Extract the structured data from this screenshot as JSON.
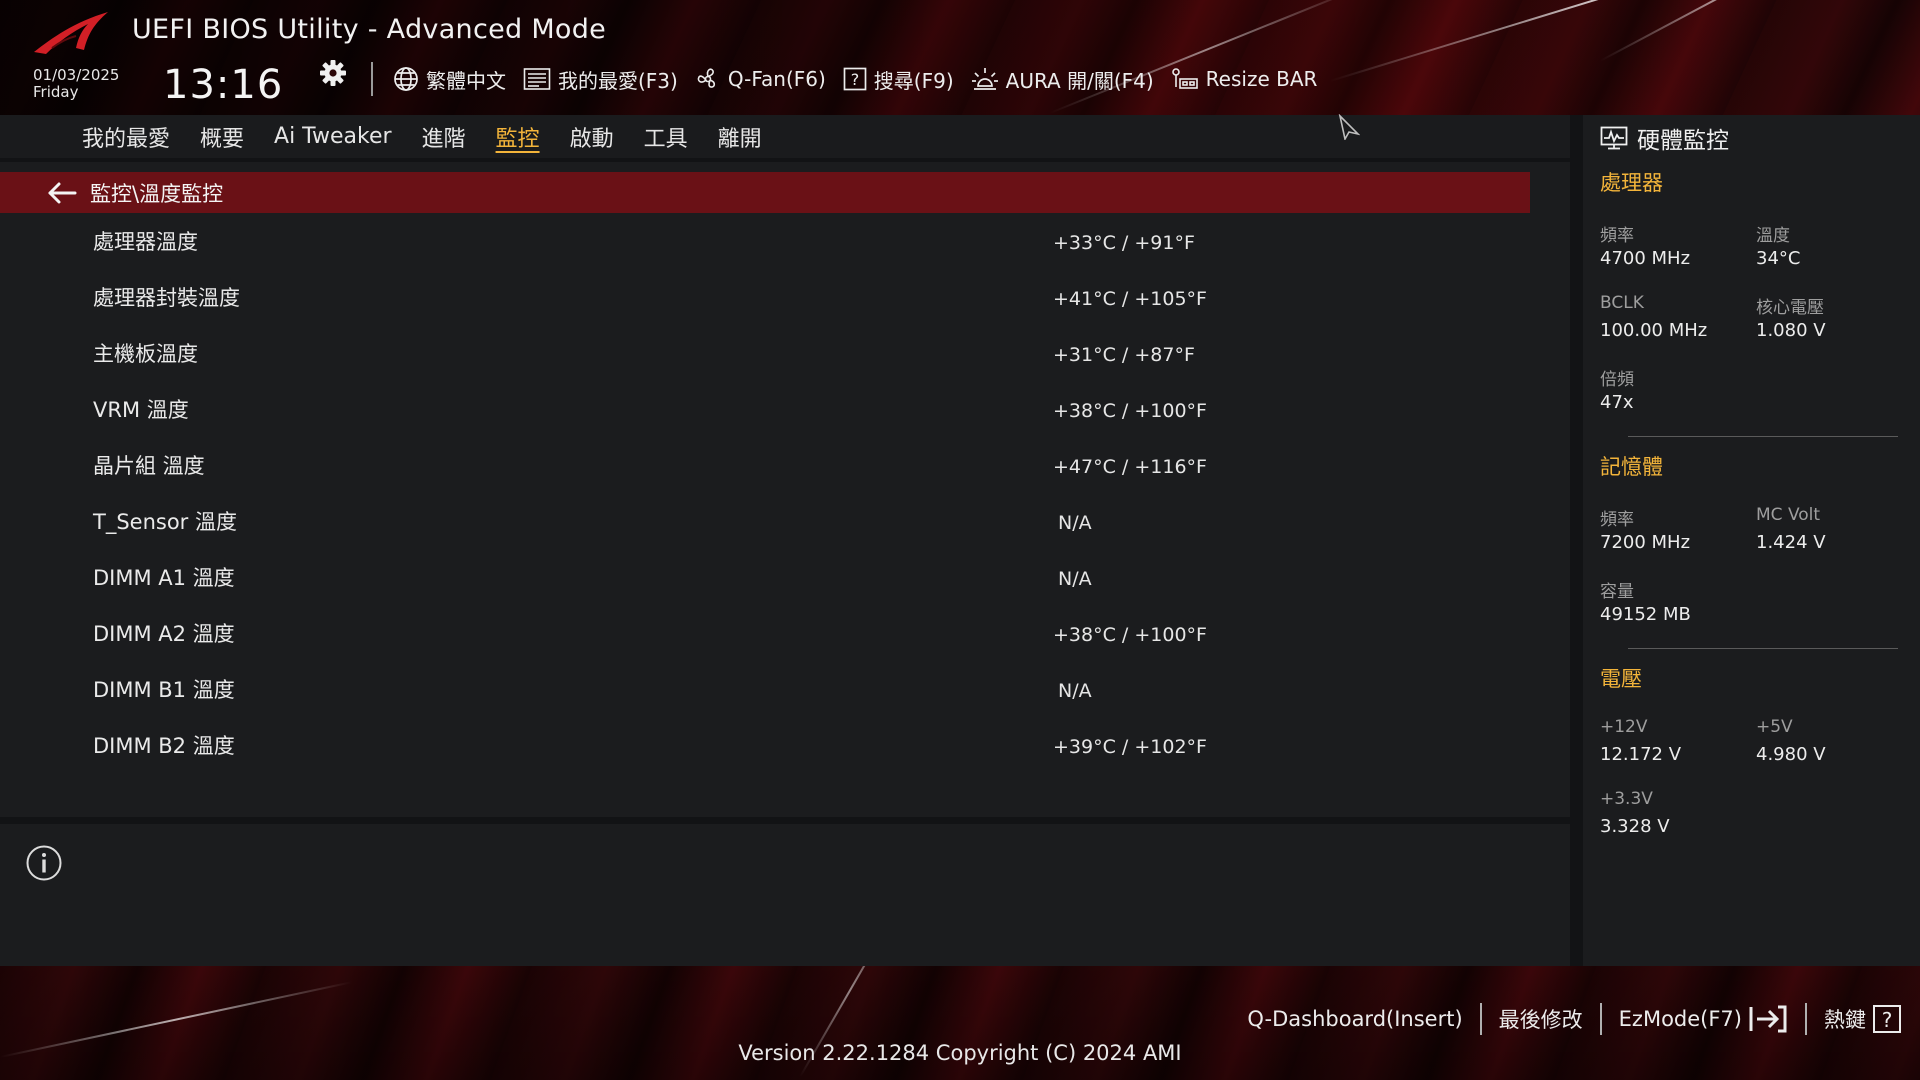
{
  "header": {
    "title": "UEFI BIOS Utility - Advanced Mode",
    "date": "01/03/2025",
    "weekday": "Friday",
    "time": "13:16"
  },
  "toolbar": {
    "language": "繁體中文",
    "favorites": "我的最愛(F3)",
    "qfan": "Q-Fan(F6)",
    "search": "搜尋(F9)",
    "aura": "AURA 開/關(F4)",
    "resize_bar": "Resize BAR"
  },
  "menu": [
    {
      "label": "我的最愛",
      "active": false
    },
    {
      "label": "概要",
      "active": false
    },
    {
      "label": "Ai Tweaker",
      "active": false
    },
    {
      "label": "進階",
      "active": false
    },
    {
      "label": "監控",
      "active": true
    },
    {
      "label": "啟動",
      "active": false
    },
    {
      "label": "工具",
      "active": false
    },
    {
      "label": "離開",
      "active": false
    }
  ],
  "breadcrumb": "監控\\溫度監控",
  "rows": [
    {
      "label": "處理器溫度",
      "value": "+33°C / +91°F"
    },
    {
      "label": "處理器封裝溫度",
      "value": "+41°C / +105°F"
    },
    {
      "label": "主機板溫度",
      "value": "+31°C / +87°F"
    },
    {
      "label": "VRM 溫度",
      "value": "+38°C / +100°F"
    },
    {
      "label": "晶片組 溫度",
      "value": "+47°C / +116°F"
    },
    {
      "label": "T_Sensor 溫度",
      "value": "N/A"
    },
    {
      "label": "DIMM A1 溫度",
      "value": "N/A"
    },
    {
      "label": "DIMM A2 溫度",
      "value": "+38°C / +100°F"
    },
    {
      "label": "DIMM B1 溫度",
      "value": "N/A"
    },
    {
      "label": "DIMM B2 溫度",
      "value": "+39°C / +102°F"
    }
  ],
  "hw_monitor": {
    "title": "硬體監控",
    "cpu": {
      "heading": "處理器",
      "freq_label": "頻率",
      "freq": "4700 MHz",
      "temp_label": "溫度",
      "temp": "34°C",
      "bclk_label": "BCLK",
      "bclk": "100.00 MHz",
      "vcore_label": "核心電壓",
      "vcore": "1.080 V",
      "ratio_label": "倍頻",
      "ratio": "47x"
    },
    "memory": {
      "heading": "記憶體",
      "freq_label": "頻率",
      "freq": "7200 MHz",
      "mcvolt_label": "MC Volt",
      "mcvolt": "1.424 V",
      "capacity_label": "容量",
      "capacity": "49152 MB"
    },
    "voltage": {
      "heading": "電壓",
      "v12_label": "+12V",
      "v12": "12.172 V",
      "v5_label": "+5V",
      "v5": "4.980 V",
      "v33_label": "+3.3V",
      "v33": "3.328 V"
    }
  },
  "footer": {
    "qdashboard": "Q-Dashboard(Insert)",
    "last_modified": "最後修改",
    "ezmode": "EzMode(F7)",
    "hotkeys": "熱鍵",
    "version": "Version 2.22.1284 Copyright (C) 2024 AMI"
  },
  "colors": {
    "accent": "#f3b43a",
    "breadcrumb_bg": "#6a1116",
    "panel_bg": "#1b1c1e",
    "header_red": "#52090d"
  }
}
